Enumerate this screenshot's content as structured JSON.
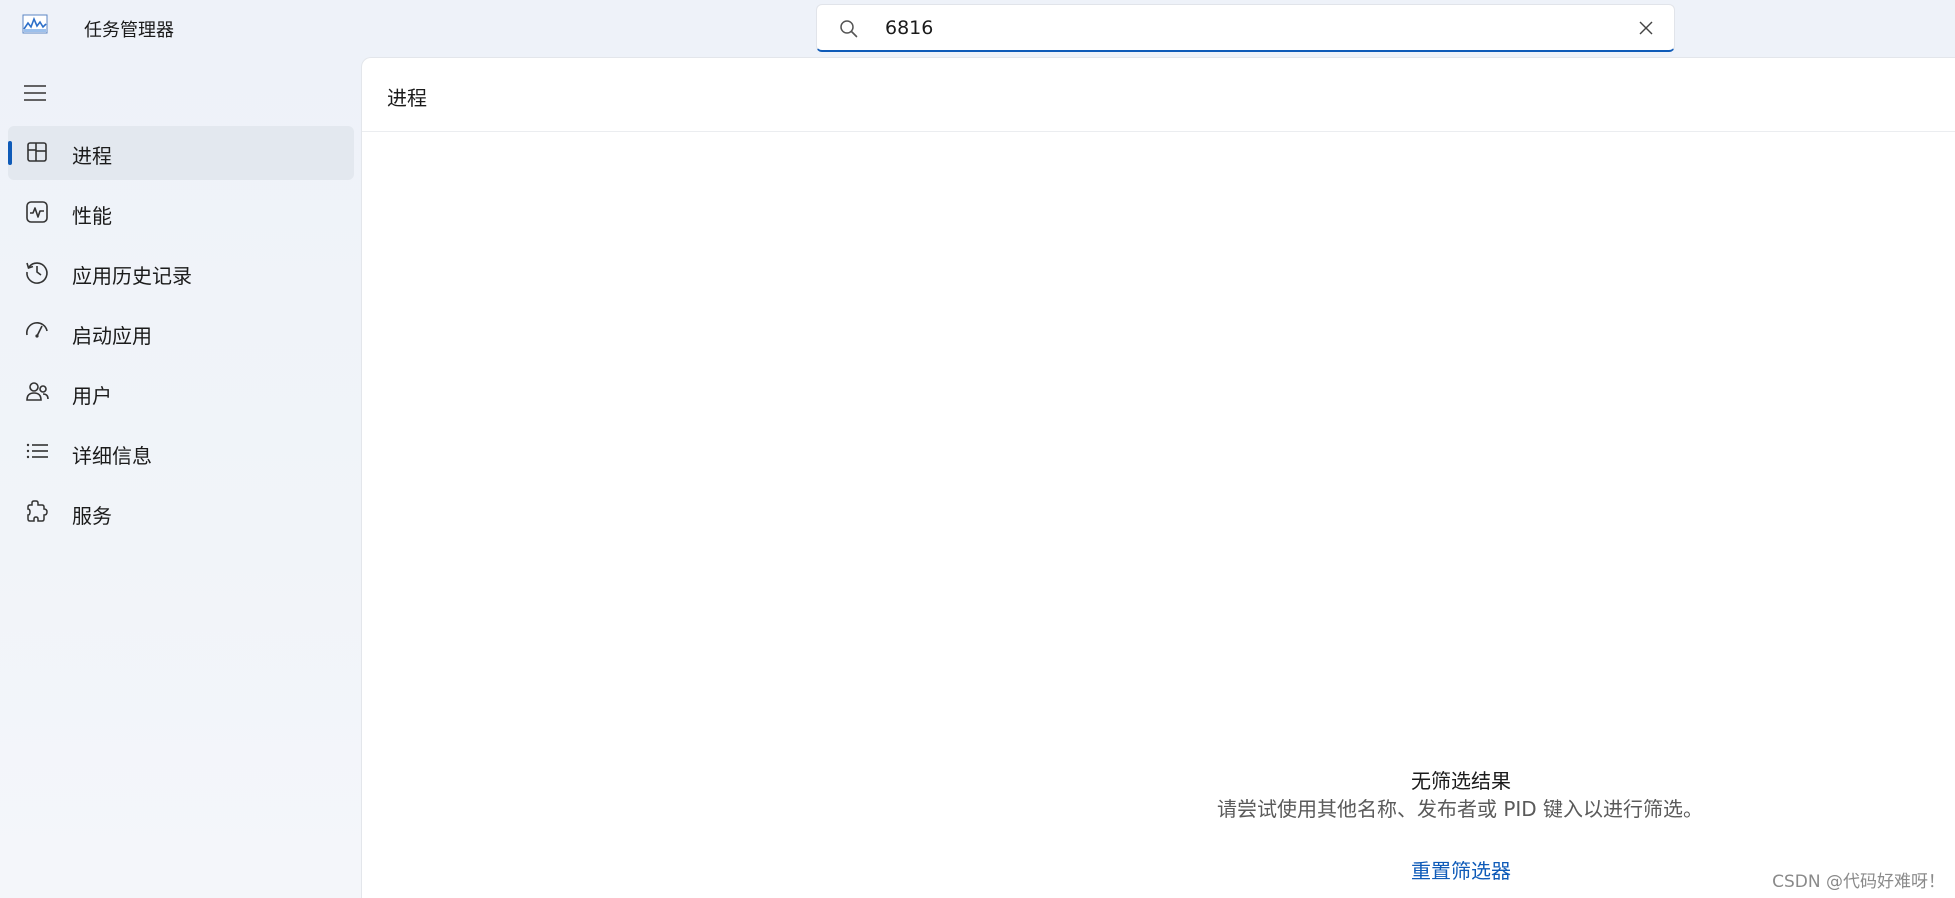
{
  "app": {
    "title": "任务管理器",
    "icon": "activity-graph-icon"
  },
  "search": {
    "value": "6816",
    "placeholder": "",
    "icon": "search-icon"
  },
  "sidebar": {
    "menu_icon": "hamburger-icon",
    "items": [
      {
        "label": "进程",
        "icon": "processes-icon",
        "active": true
      },
      {
        "label": "性能",
        "icon": "performance-icon",
        "active": false
      },
      {
        "label": "应用历史记录",
        "icon": "history-icon",
        "active": false
      },
      {
        "label": "启动应用",
        "icon": "startup-icon",
        "active": false
      },
      {
        "label": "用户",
        "icon": "users-icon",
        "active": false
      },
      {
        "label": "详细信息",
        "icon": "details-list-icon",
        "active": false
      },
      {
        "label": "服务",
        "icon": "services-icon",
        "active": false
      }
    ]
  },
  "main": {
    "title": "进程",
    "empty_title": "无筛选结果",
    "empty_desc": "请尝试使用其他名称、发布者或 PID 键入以进行筛选。",
    "reset_label": "重置筛选器"
  },
  "watermark": "CSDN @代码好难呀！",
  "colors": {
    "accent": "#0f5bb8",
    "background": "#eef2f8",
    "panel": "#ffffff",
    "active_item": "#e3e8ef"
  }
}
